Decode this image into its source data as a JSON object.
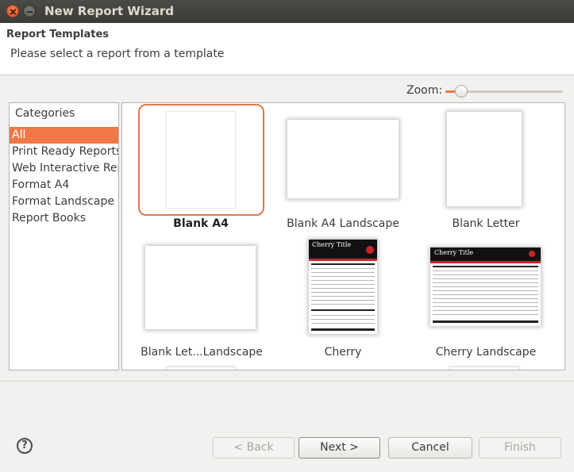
{
  "window": {
    "title": "New Report Wizard"
  },
  "header": {
    "title": "Report Templates",
    "message": "Please select a report from a template"
  },
  "zoom": {
    "label": "Zoom:",
    "level_fraction": 0.1
  },
  "categories": {
    "header": "Categories",
    "items": [
      "All",
      "Print Ready Reports",
      "Web Interactive Reports",
      "Format A4",
      "Format Landscape",
      "Report Books"
    ],
    "selected": "All"
  },
  "templates": [
    {
      "name": "Blank A4",
      "selected": true
    },
    {
      "name": "Blank A4 Landscape"
    },
    {
      "name": "Blank Letter"
    },
    {
      "name": "Blank Let...Landscape"
    },
    {
      "name": "Cherry",
      "preview_title": "Cherry Title"
    },
    {
      "name": "Cherry Landscape",
      "preview_title": "Cherry Title"
    }
  ],
  "buttons": {
    "back": "< Back",
    "next": "Next >",
    "cancel": "Cancel",
    "finish": "Finish"
  },
  "icons": {
    "help": "help-icon",
    "close": "close-icon",
    "minimize": "minimize-icon"
  },
  "colors": {
    "accent": "#f07746",
    "titlebar": "#3c3b37"
  }
}
